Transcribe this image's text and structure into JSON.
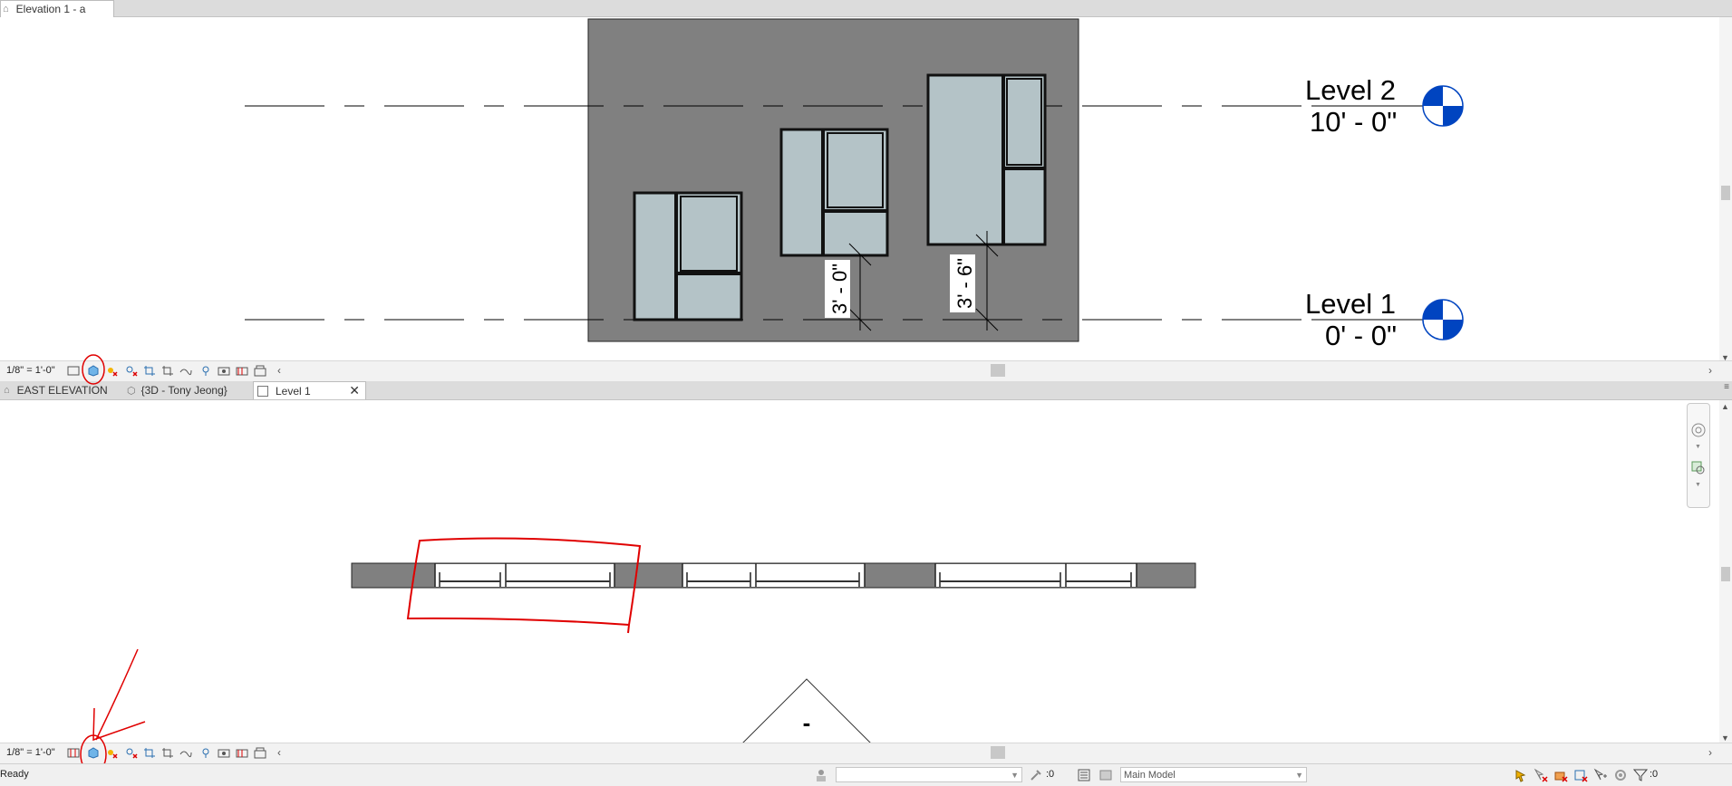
{
  "top_view": {
    "tab_label": "Elevation 1 - a",
    "levels": [
      {
        "name": "Level 2",
        "elevation": "10' - 0\""
      },
      {
        "name": "Level 1",
        "elevation": "0' - 0\""
      }
    ],
    "dimensions": [
      "3' - 0\"",
      "3' - 6\""
    ],
    "scale": "1/8\" = 1'-0\""
  },
  "bottom_view": {
    "tabs": [
      {
        "label": "EAST ELEVATION"
      },
      {
        "label": "{3D - Tony Jeong}"
      },
      {
        "label": "Level 1"
      }
    ],
    "scale": "1/8\" = 1'-0\"",
    "elevation_marker_label": "-"
  },
  "status_bar": {
    "status_text": "Ready",
    "worksets_value": ":0",
    "model_value": "Main Model",
    "filter_value": ":0"
  },
  "colors": {
    "wall": "#808080",
    "glass": "#b4c3c7",
    "frame": "#111111",
    "markup_red": "#e00000",
    "level_head_blue": "#0044c0"
  }
}
